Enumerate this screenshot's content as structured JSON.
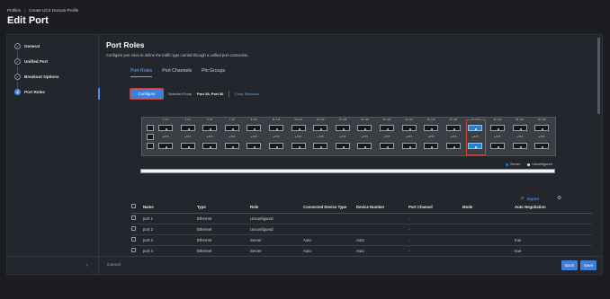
{
  "breadcrumb": [
    "Profiles",
    "Create UCS Domain Profile"
  ],
  "page_title": "Edit Port",
  "steps": [
    {
      "label": "General",
      "state": "done"
    },
    {
      "label": "Unified Port",
      "state": "done"
    },
    {
      "label": "Breakout Options",
      "state": "done"
    },
    {
      "label": "Port Roles",
      "state": "active",
      "number": "4"
    }
  ],
  "section": {
    "title": "Port Roles",
    "subtitle": "Configure port roles to define the traffic type carried through a unified port connection."
  },
  "tabs": [
    "Port Roles",
    "Port Channels",
    "Pin Groups"
  ],
  "selection": {
    "configure_label": "Configure",
    "selected_label": "Selected Ports",
    "selected_value": "Port 29, Port 30",
    "clear_label": "Clear Selection"
  },
  "switch_ports": [
    {
      "top": "1  ⊙2",
      "bottom": "● 5 5 5"
    },
    {
      "top": "3  ⊙4",
      "bottom": "● 5 5 5"
    },
    {
      "top": "5  ⊙6",
      "bottom": "● 5 5 5"
    },
    {
      "top": "7  ⊙8",
      "bottom": "● 5 5 5"
    },
    {
      "top": "9  ⊙10",
      "bottom": "● 5 5 5"
    },
    {
      "top": "11 ⊙12",
      "bottom": "● 5 5 5"
    },
    {
      "top": "13 ⊙14",
      "bottom": "● 5 5 5"
    },
    {
      "top": "15 ⊙16",
      "bottom": "● 5 5 5"
    },
    {
      "top": "17 ⊙18",
      "bottom": "● 5 5 5"
    },
    {
      "top": "19 ⊙20",
      "bottom": "● 5 5 5"
    },
    {
      "top": "21 ⊙22",
      "bottom": "● 5 5 5"
    },
    {
      "top": "23 ⊙24",
      "bottom": "● 5 5 5"
    },
    {
      "top": "25 ⊙26",
      "bottom": "● 5 5 5"
    },
    {
      "top": "27 ⊙28",
      "bottom": "● 5 5 5"
    },
    {
      "top": "29 ⊙30",
      "bottom": "● 5 5 5",
      "server": true
    },
    {
      "top": "31 ⊙32",
      "bottom": "● 5 5 5"
    },
    {
      "top": "33 ⊙34",
      "bottom": "● 5 5 5"
    },
    {
      "top": "35 ⊙36",
      "bottom": "● 5 5 5"
    }
  ],
  "legend": [
    {
      "label": "Server",
      "color": "#2a7fc9"
    },
    {
      "label": "Unconfigured",
      "color": "#e6e8eb"
    }
  ],
  "export_label": "Export",
  "table": {
    "columns": [
      "Name",
      "Type",
      "Role",
      "Connected Device Type",
      "Device Number",
      "Port Channel",
      "Mode",
      "Auto Negotiation"
    ],
    "rows": [
      [
        "port 1",
        "Ethernet",
        "Unconfigured",
        "",
        "",
        "-",
        "",
        ""
      ],
      [
        "port 2",
        "Ethernet",
        "Unconfigured",
        "",
        "",
        "-",
        "",
        ""
      ],
      [
        "port 3",
        "Ethernet",
        "Server",
        "Auto",
        "Auto",
        "-",
        "",
        "true"
      ],
      [
        "port 4",
        "Ethernet",
        "Server",
        "Auto",
        "Auto",
        "-",
        "",
        "true"
      ]
    ]
  },
  "footer": {
    "cancel": "Cancel",
    "back": "Back",
    "save": "Save"
  },
  "colors": {
    "accent": "#3d7fd9",
    "link": "#6ea8f5",
    "highlight": "#c8453b",
    "server": "#2a7fc9"
  }
}
